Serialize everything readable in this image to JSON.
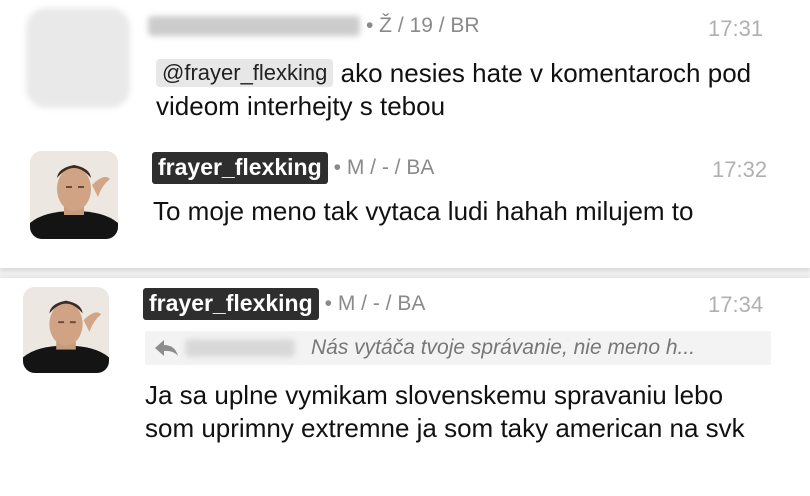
{
  "messages": [
    {
      "user_info": "• Ž / 19 / BR",
      "time": "17:31",
      "mention": "@frayer_flexking",
      "text": " ako nesies hate v komentaroch pod videom interhejty s tebou"
    },
    {
      "username": "frayer_flexking",
      "user_info": "• M / - / BA",
      "time": "17:32",
      "text": "To moje meno tak vytaca ludi hahah milujem to"
    },
    {
      "username": "frayer_flexking",
      "user_info": "• M / - / BA",
      "time": "17:34",
      "reply_preview": "Nás vytáča tvoje správanie, nie meno h...",
      "text": "Ja sa uplne vymikam slovenskemu spravaniu lebo som uprimny extremne ja som taky american na svk"
    }
  ]
}
